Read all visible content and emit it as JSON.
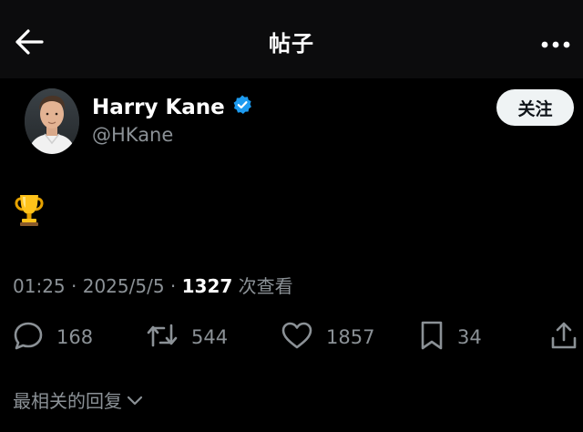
{
  "header": {
    "title": "帖子",
    "back_icon": "arrow-left-icon",
    "more_icon": "more-horizontal-icon"
  },
  "author": {
    "name": "Harry Kane",
    "handle": "@HKane",
    "verified": true,
    "verified_color": "#1d9bf0",
    "follow_label": "关注"
  },
  "tweet": {
    "content_icon": "trophy-emoji"
  },
  "meta": {
    "time": "01:25",
    "separator1": " · ",
    "date": "2025/5/5",
    "separator2": " · ",
    "views_count": "1327",
    "views_label": " 次查看"
  },
  "actions": {
    "replies": "168",
    "reposts": "544",
    "likes": "1857",
    "bookmarks": "34"
  },
  "replies_sort": {
    "label": "最相关的回复"
  },
  "colors": {
    "background": "#000000",
    "text_primary": "#ffffff",
    "text_secondary": "#8b9196",
    "follow_bg": "#eff3f4"
  }
}
